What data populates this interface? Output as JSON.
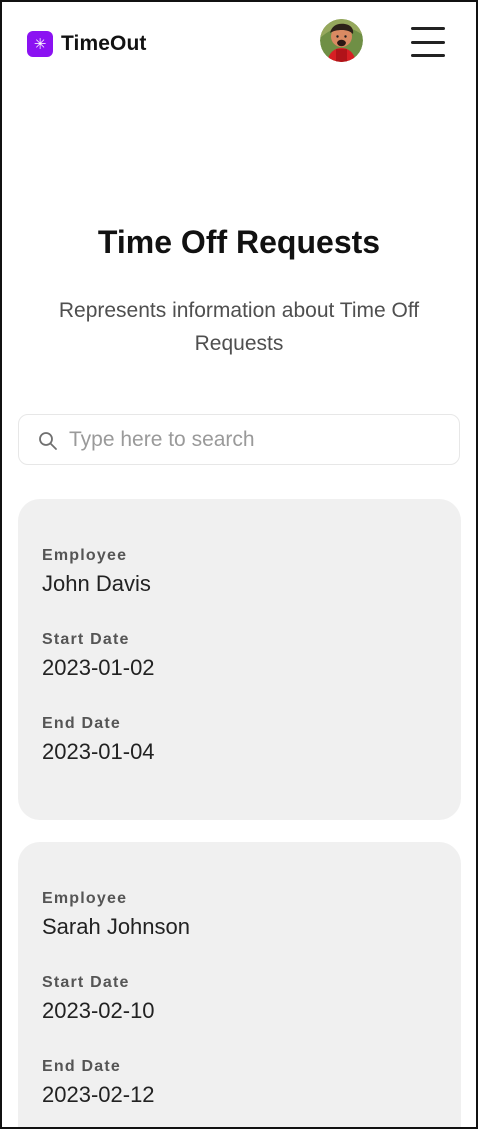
{
  "app": {
    "brand_icon": "✳",
    "brand_name": "TimeOut",
    "brand_color": "#8b12f2"
  },
  "header": {
    "avatar_icon": "user-avatar-icon",
    "menu_icon": "hamburger-menu-icon"
  },
  "page": {
    "title": "Time Off Requests",
    "subtitle": "Represents information about Time Off Requests"
  },
  "search": {
    "icon": "search-icon",
    "placeholder": "Type here to search",
    "value": ""
  },
  "requests": [
    {
      "employee_label": "Employee",
      "employee": "John Davis",
      "start_label": "Start Date",
      "start_date": "2023-01-02",
      "end_label": "End Date",
      "end_date": "2023-01-04"
    },
    {
      "employee_label": "Employee",
      "employee": "Sarah Johnson",
      "start_label": "Start Date",
      "start_date": "2023-02-10",
      "end_label": "End Date",
      "end_date": "2023-02-12"
    }
  ]
}
